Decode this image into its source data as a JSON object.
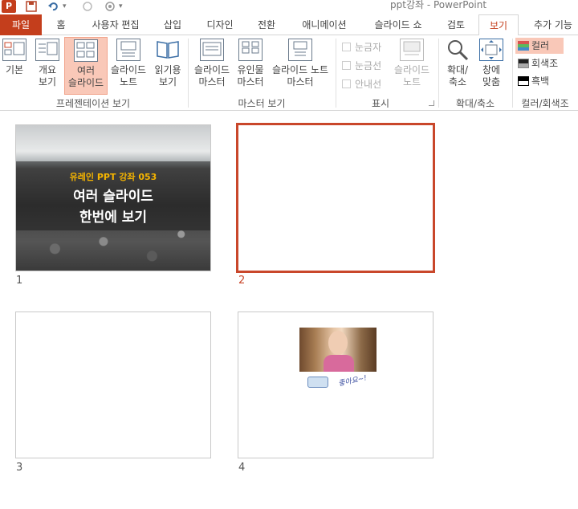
{
  "app": {
    "icon_letter": "P",
    "window_title": "ppt강좌 - PowerPoint"
  },
  "tabs": [
    {
      "label": "파일"
    },
    {
      "label": "홈"
    },
    {
      "label": "사용자 편집"
    },
    {
      "label": "삽입"
    },
    {
      "label": "디자인"
    },
    {
      "label": "전환"
    },
    {
      "label": "애니메이션"
    },
    {
      "label": "슬라이드 쇼"
    },
    {
      "label": "검토"
    },
    {
      "label": "보기"
    },
    {
      "label": "추가 기능"
    }
  ],
  "ribbon": {
    "presentation_views": {
      "group_label": "프레젠테이션 보기",
      "buttons": [
        {
          "line1": "기본",
          "line2": ""
        },
        {
          "line1": "개요",
          "line2": "보기"
        },
        {
          "line1": "여러",
          "line2": "슬라이드"
        },
        {
          "line1": "슬라이드",
          "line2": "노트"
        },
        {
          "line1": "읽기용",
          "line2": "보기"
        }
      ]
    },
    "master_views": {
      "group_label": "마스터 보기",
      "buttons": [
        {
          "line1": "슬라이드",
          "line2": "마스터"
        },
        {
          "line1": "유인물",
          "line2": "마스터"
        },
        {
          "line1": "슬라이드 노트",
          "line2": "마스터"
        }
      ]
    },
    "show": {
      "group_label": "표시",
      "checkboxes": [
        {
          "label": "눈금자"
        },
        {
          "label": "눈금선"
        },
        {
          "label": "안내선"
        }
      ],
      "notes_button": {
        "line1": "슬라이드",
        "line2": "노트"
      }
    },
    "zoom": {
      "group_label": "확대/축소",
      "buttons": [
        {
          "line1": "확대/",
          "line2": "축소"
        },
        {
          "line1": "창에",
          "line2": "맞춤"
        }
      ]
    },
    "color": {
      "group_label": "컬러/회색조",
      "options": [
        {
          "label": "컬러"
        },
        {
          "label": "회색조"
        },
        {
          "label": "흑백"
        }
      ]
    }
  },
  "slides": [
    {
      "number": "1",
      "subtitle": "유레인 PPT 강좌 053",
      "title_line1": "여러 슬라이드",
      "title_line2": "한번에 보기"
    },
    {
      "number": "2"
    },
    {
      "number": "3"
    },
    {
      "number": "4",
      "signature": "좋아요~!"
    }
  ],
  "colors": {
    "accent": "#c43e1c",
    "selected_border": "#c9472b",
    "selected_button": "#f9c8b8"
  }
}
